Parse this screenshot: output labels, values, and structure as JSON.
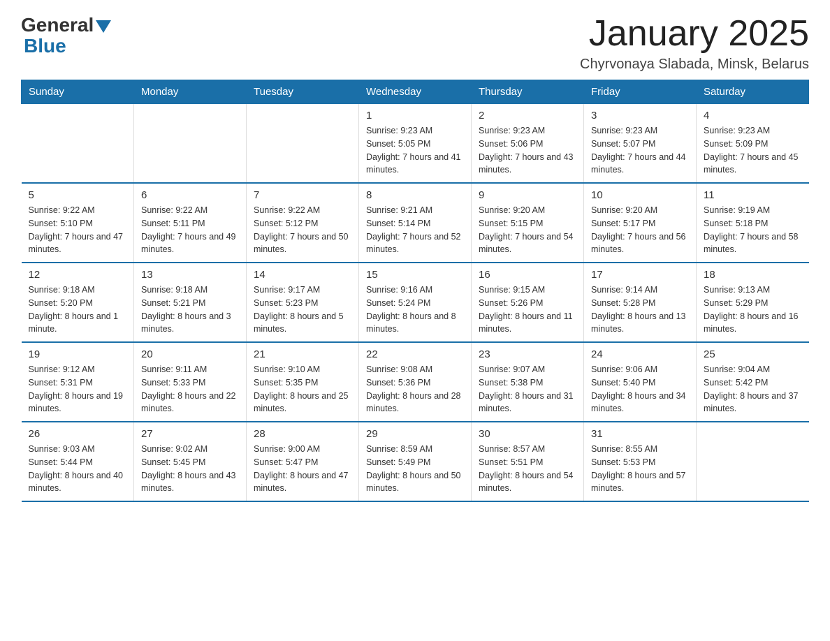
{
  "logo": {
    "general": "General",
    "blue": "Blue"
  },
  "header": {
    "title": "January 2025",
    "subtitle": "Chyrvonaya Slabada, Minsk, Belarus"
  },
  "weekdays": [
    "Sunday",
    "Monday",
    "Tuesday",
    "Wednesday",
    "Thursday",
    "Friday",
    "Saturday"
  ],
  "weeks": [
    [
      {
        "day": "",
        "info": ""
      },
      {
        "day": "",
        "info": ""
      },
      {
        "day": "",
        "info": ""
      },
      {
        "day": "1",
        "info": "Sunrise: 9:23 AM\nSunset: 5:05 PM\nDaylight: 7 hours\nand 41 minutes."
      },
      {
        "day": "2",
        "info": "Sunrise: 9:23 AM\nSunset: 5:06 PM\nDaylight: 7 hours\nand 43 minutes."
      },
      {
        "day": "3",
        "info": "Sunrise: 9:23 AM\nSunset: 5:07 PM\nDaylight: 7 hours\nand 44 minutes."
      },
      {
        "day": "4",
        "info": "Sunrise: 9:23 AM\nSunset: 5:09 PM\nDaylight: 7 hours\nand 45 minutes."
      }
    ],
    [
      {
        "day": "5",
        "info": "Sunrise: 9:22 AM\nSunset: 5:10 PM\nDaylight: 7 hours\nand 47 minutes."
      },
      {
        "day": "6",
        "info": "Sunrise: 9:22 AM\nSunset: 5:11 PM\nDaylight: 7 hours\nand 49 minutes."
      },
      {
        "day": "7",
        "info": "Sunrise: 9:22 AM\nSunset: 5:12 PM\nDaylight: 7 hours\nand 50 minutes."
      },
      {
        "day": "8",
        "info": "Sunrise: 9:21 AM\nSunset: 5:14 PM\nDaylight: 7 hours\nand 52 minutes."
      },
      {
        "day": "9",
        "info": "Sunrise: 9:20 AM\nSunset: 5:15 PM\nDaylight: 7 hours\nand 54 minutes."
      },
      {
        "day": "10",
        "info": "Sunrise: 9:20 AM\nSunset: 5:17 PM\nDaylight: 7 hours\nand 56 minutes."
      },
      {
        "day": "11",
        "info": "Sunrise: 9:19 AM\nSunset: 5:18 PM\nDaylight: 7 hours\nand 58 minutes."
      }
    ],
    [
      {
        "day": "12",
        "info": "Sunrise: 9:18 AM\nSunset: 5:20 PM\nDaylight: 8 hours\nand 1 minute."
      },
      {
        "day": "13",
        "info": "Sunrise: 9:18 AM\nSunset: 5:21 PM\nDaylight: 8 hours\nand 3 minutes."
      },
      {
        "day": "14",
        "info": "Sunrise: 9:17 AM\nSunset: 5:23 PM\nDaylight: 8 hours\nand 5 minutes."
      },
      {
        "day": "15",
        "info": "Sunrise: 9:16 AM\nSunset: 5:24 PM\nDaylight: 8 hours\nand 8 minutes."
      },
      {
        "day": "16",
        "info": "Sunrise: 9:15 AM\nSunset: 5:26 PM\nDaylight: 8 hours\nand 11 minutes."
      },
      {
        "day": "17",
        "info": "Sunrise: 9:14 AM\nSunset: 5:28 PM\nDaylight: 8 hours\nand 13 minutes."
      },
      {
        "day": "18",
        "info": "Sunrise: 9:13 AM\nSunset: 5:29 PM\nDaylight: 8 hours\nand 16 minutes."
      }
    ],
    [
      {
        "day": "19",
        "info": "Sunrise: 9:12 AM\nSunset: 5:31 PM\nDaylight: 8 hours\nand 19 minutes."
      },
      {
        "day": "20",
        "info": "Sunrise: 9:11 AM\nSunset: 5:33 PM\nDaylight: 8 hours\nand 22 minutes."
      },
      {
        "day": "21",
        "info": "Sunrise: 9:10 AM\nSunset: 5:35 PM\nDaylight: 8 hours\nand 25 minutes."
      },
      {
        "day": "22",
        "info": "Sunrise: 9:08 AM\nSunset: 5:36 PM\nDaylight: 8 hours\nand 28 minutes."
      },
      {
        "day": "23",
        "info": "Sunrise: 9:07 AM\nSunset: 5:38 PM\nDaylight: 8 hours\nand 31 minutes."
      },
      {
        "day": "24",
        "info": "Sunrise: 9:06 AM\nSunset: 5:40 PM\nDaylight: 8 hours\nand 34 minutes."
      },
      {
        "day": "25",
        "info": "Sunrise: 9:04 AM\nSunset: 5:42 PM\nDaylight: 8 hours\nand 37 minutes."
      }
    ],
    [
      {
        "day": "26",
        "info": "Sunrise: 9:03 AM\nSunset: 5:44 PM\nDaylight: 8 hours\nand 40 minutes."
      },
      {
        "day": "27",
        "info": "Sunrise: 9:02 AM\nSunset: 5:45 PM\nDaylight: 8 hours\nand 43 minutes."
      },
      {
        "day": "28",
        "info": "Sunrise: 9:00 AM\nSunset: 5:47 PM\nDaylight: 8 hours\nand 47 minutes."
      },
      {
        "day": "29",
        "info": "Sunrise: 8:59 AM\nSunset: 5:49 PM\nDaylight: 8 hours\nand 50 minutes."
      },
      {
        "day": "30",
        "info": "Sunrise: 8:57 AM\nSunset: 5:51 PM\nDaylight: 8 hours\nand 54 minutes."
      },
      {
        "day": "31",
        "info": "Sunrise: 8:55 AM\nSunset: 5:53 PM\nDaylight: 8 hours\nand 57 minutes."
      },
      {
        "day": "",
        "info": ""
      }
    ]
  ]
}
